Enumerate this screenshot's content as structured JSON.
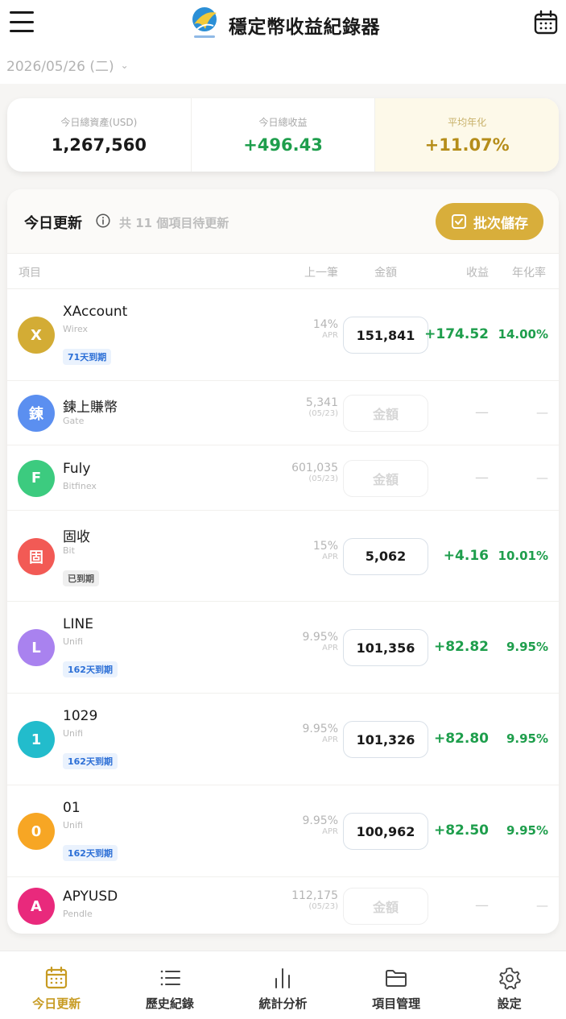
{
  "header": {
    "title": "穩定幣收益紀錄器",
    "date": "2026/05/26 (二)"
  },
  "summary": {
    "total_assets_label": "今日總資產(USD)",
    "total_assets": "1,267,560",
    "total_gain_label": "今日總收益",
    "total_gain": "+496.43",
    "avg_apr_label": "平均年化",
    "avg_apr": "+11.07%"
  },
  "updates": {
    "title": "今日更新",
    "pending": "共 11 個項目待更新",
    "batch_save": "批次儲存",
    "columns": {
      "item": "項目",
      "prev": "上一筆",
      "amount": "金額",
      "gain": "收益",
      "apr": "年化率"
    },
    "amount_placeholder": "金額",
    "dash": "—",
    "rows": [
      {
        "initial": "X",
        "color": "#d3ac35",
        "name": "XAccount",
        "platform": "Wirex",
        "badge": "71天到期",
        "badge_type": "blue",
        "prev": "14%",
        "prev_sub": "APR",
        "amount": "151,841",
        "gain": "+174.52",
        "apr": "14.00%"
      },
      {
        "initial": "鍊",
        "color": "#5b8ff0",
        "name": "鍊上賺幣",
        "platform": "Gate",
        "badge": "",
        "badge_type": "",
        "prev": "5,341",
        "prev_sub": "(05/23)",
        "amount": "",
        "gain": "",
        "apr": ""
      },
      {
        "initial": "F",
        "color": "#3ccb7f",
        "name": "Fuly",
        "platform": "Bitfinex",
        "badge": "",
        "badge_type": "",
        "prev": "601,035",
        "prev_sub": "(05/23)",
        "amount": "",
        "gain": "",
        "apr": ""
      },
      {
        "initial": "固",
        "color": "#f25a55",
        "name": "固收",
        "platform": "Bit",
        "badge": "已到期",
        "badge_type": "gray",
        "prev": "15%",
        "prev_sub": "APR",
        "amount": "5,062",
        "gain": "+4.16",
        "apr": "10.01%"
      },
      {
        "initial": "L",
        "color": "#a982ef",
        "name": "LINE",
        "platform": "Unifi",
        "badge": "162天到期",
        "badge_type": "blue",
        "prev": "9.95%",
        "prev_sub": "APR",
        "amount": "101,356",
        "gain": "+82.82",
        "apr": "9.95%"
      },
      {
        "initial": "1",
        "color": "#22bccc",
        "name": "1029",
        "platform": "Unifi",
        "badge": "162天到期",
        "badge_type": "blue",
        "prev": "9.95%",
        "prev_sub": "APR",
        "amount": "101,326",
        "gain": "+82.80",
        "apr": "9.95%"
      },
      {
        "initial": "0",
        "color": "#f7a624",
        "name": "01",
        "platform": "Unifi",
        "badge": "162天到期",
        "badge_type": "blue",
        "prev": "9.95%",
        "prev_sub": "APR",
        "amount": "100,962",
        "gain": "+82.50",
        "apr": "9.95%"
      },
      {
        "initial": "A",
        "color": "#e9297c",
        "name": "APYUSD",
        "platform": "Pendle",
        "badge": "",
        "badge_type": "",
        "prev": "112,175",
        "prev_sub": "(05/23)",
        "amount": "",
        "gain": "",
        "apr": ""
      }
    ]
  },
  "nav": [
    {
      "label": "今日更新",
      "icon": "calendar-icon",
      "active": true
    },
    {
      "label": "歷史紀錄",
      "icon": "list-icon",
      "active": false
    },
    {
      "label": "統計分析",
      "icon": "bar-chart-icon",
      "active": false
    },
    {
      "label": "項目管理",
      "icon": "folder-icon",
      "active": false
    },
    {
      "label": "設定",
      "icon": "gear-icon",
      "active": false
    }
  ]
}
